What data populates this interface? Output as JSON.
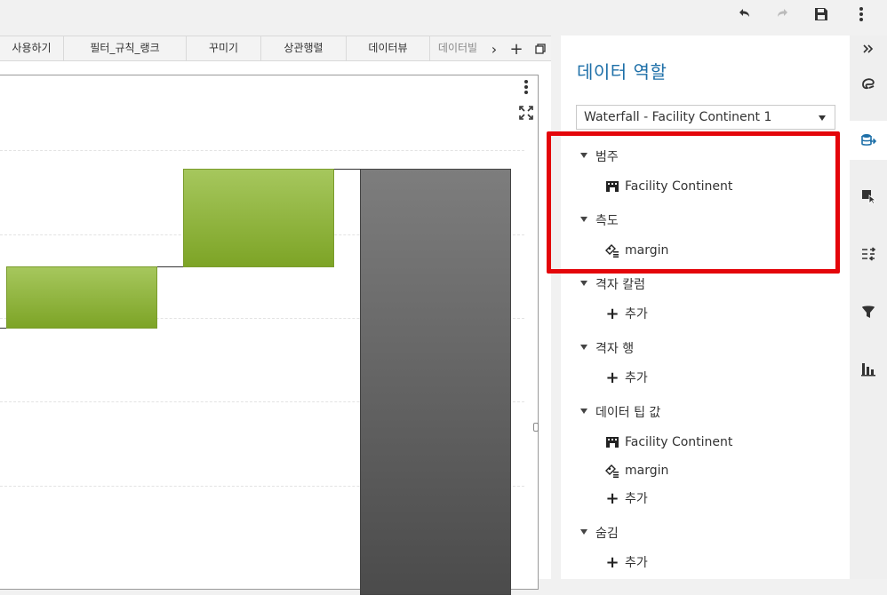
{
  "toolbar": {
    "icons": [
      "undo-icon",
      "redo-icon",
      "save-icon",
      "more-vertical-icon"
    ]
  },
  "tabs": {
    "items": [
      "사용하기",
      "필터_규칙_랭크",
      "꾸미기",
      "상관행렬",
      "데이터뷰",
      "데이터빌"
    ],
    "next_label": "›",
    "add_label": "+"
  },
  "chart_data": {
    "type": "bar",
    "subtype": "waterfall",
    "bars": [
      {
        "kind": "increase",
        "color": "#8db33a"
      },
      {
        "kind": "increase",
        "color": "#8db33a"
      },
      {
        "kind": "total",
        "color": "#5f5f5f"
      }
    ],
    "grid": true
  },
  "panel": {
    "title": "데이터 역할",
    "select_value": "Waterfall - Facility Continent 1",
    "sections": [
      {
        "label": "범주",
        "items": [
          {
            "icon": "category-icon",
            "label": "Facility Continent"
          }
        ]
      },
      {
        "label": "측도",
        "items": [
          {
            "icon": "measure-icon",
            "label": "margin"
          }
        ]
      },
      {
        "label": "격자 칼럼",
        "items": [
          {
            "icon": "plus-icon",
            "label": "추가"
          }
        ]
      },
      {
        "label": "격자 행",
        "items": [
          {
            "icon": "plus-icon",
            "label": "추가"
          }
        ]
      },
      {
        "label": "데이터 팁 값",
        "items": [
          {
            "icon": "category-icon",
            "label": "Facility Continent"
          },
          {
            "icon": "measure-icon",
            "label": "margin"
          },
          {
            "icon": "plus-icon",
            "label": "추가"
          }
        ]
      },
      {
        "label": "숨김",
        "items": [
          {
            "icon": "plus-icon",
            "label": "추가"
          }
        ]
      }
    ]
  },
  "rail": {
    "icons": [
      "collapse-icon",
      "palette-icon",
      "data-roles-icon",
      "actions-icon",
      "rules-icon",
      "filter-icon",
      "ranks-icon"
    ],
    "active": "data-roles-icon"
  },
  "highlight_color": "#e4050a"
}
